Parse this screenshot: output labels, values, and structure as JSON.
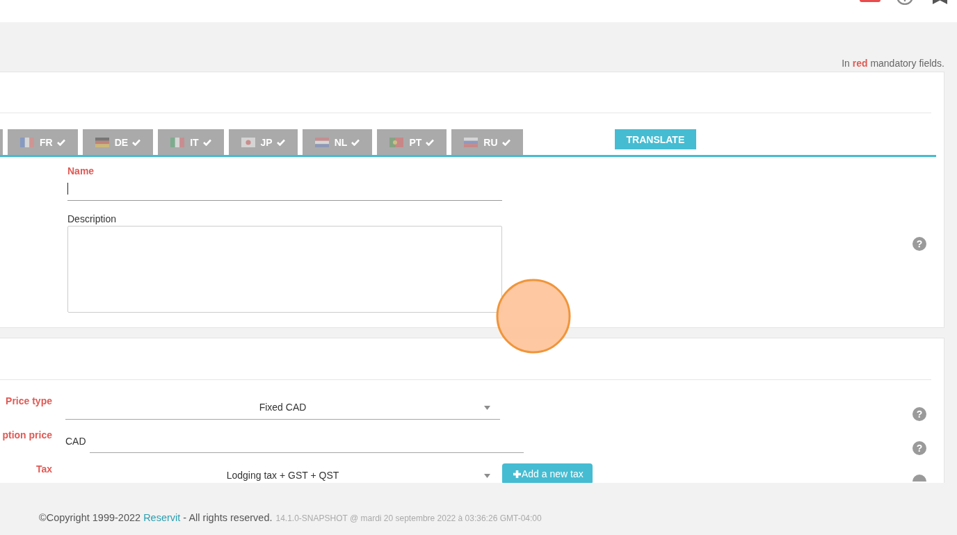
{
  "mandatory_note": "In **red** mandatory fields.",
  "translation_panel": {
    "language_tabs": [
      {
        "label": "FR",
        "kind": "france",
        "translated": true,
        "selected": false
      },
      {
        "label": "DE",
        "kind": "germany",
        "translated": true,
        "selected": false
      },
      {
        "label": "IT",
        "kind": "italy",
        "translated": true,
        "selected": false
      },
      {
        "label": "JP",
        "kind": "japan",
        "translated": true,
        "selected": false
      },
      {
        "label": "NL",
        "kind": "netherlands",
        "translated": true,
        "selected": false
      },
      {
        "label": "PT",
        "kind": "portugal",
        "translated": true,
        "selected": false
      },
      {
        "label": "RU",
        "kind": "russia",
        "translated": true,
        "selected": false
      }
    ],
    "translate_button": "TRANSLATE",
    "fields": [
      {
        "kind": "input",
        "label": "Name",
        "required": true,
        "focused": true
      },
      {
        "kind": "textarea",
        "label": "Description",
        "required": false
      }
    ],
    "help": "?"
  },
  "price_panel": {
    "fields": [
      {
        "kind": "select",
        "label": "Price type",
        "required": true,
        "value": "Fixed CAD",
        "help": "?"
      },
      {
        "kind": "money",
        "label": "ption price",
        "required": true,
        "prefix": "CAD",
        "help": "?"
      },
      {
        "kind": "select",
        "label": "Tax",
        "required": true,
        "value": "Lodging tax + GST + QST",
        "action": "Add a new tax"
      }
    ]
  },
  "footer": {
    "copyright_before": "©Copyright 1999-2022",
    "link": "Reservit",
    "copyright_after": "- All rights reserved.",
    "version": "14.1.0-SNAPSHOT @ mardi 20 septembre 2022 à 03:36:26 GMT-04:00"
  }
}
